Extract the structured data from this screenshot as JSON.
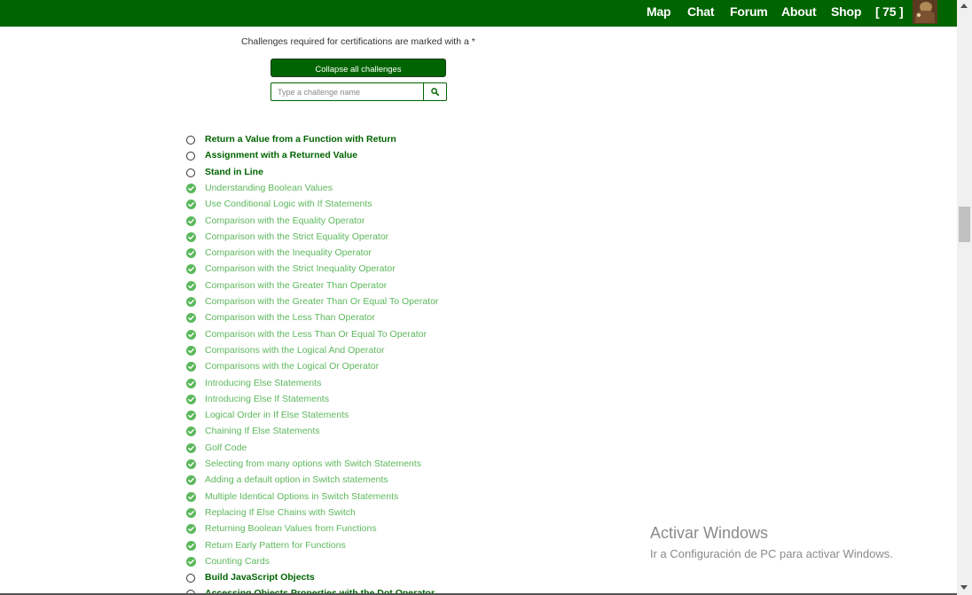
{
  "navbar": {
    "links": [
      "Map",
      "Chat",
      "Forum",
      "About",
      "Shop"
    ],
    "points": "[ 75 ]",
    "colors": {
      "background": "#006400",
      "text": "#ffffff"
    }
  },
  "intro": {
    "note": "Challenges required for certifications are marked with a *",
    "collapse_label": "Collapse all challenges",
    "search_placeholder": "Type a challenge name",
    "search_icon": "search-icon"
  },
  "challenges": [
    {
      "label": "Return a Value from a Function with Return",
      "done": false
    },
    {
      "label": "Assignment with a Returned Value",
      "done": false
    },
    {
      "label": "Stand in Line",
      "done": false
    },
    {
      "label": "Understanding Boolean Values",
      "done": true
    },
    {
      "label": "Use Conditional Logic with If Statements",
      "done": true
    },
    {
      "label": "Comparison with the Equality Operator",
      "done": true
    },
    {
      "label": "Comparison with the Strict Equality Operator",
      "done": true
    },
    {
      "label": "Comparison with the Inequality Operator",
      "done": true
    },
    {
      "label": "Comparison with the Strict Inequality Operator",
      "done": true
    },
    {
      "label": "Comparison with the Greater Than Operator",
      "done": true
    },
    {
      "label": "Comparison with the Greater Than Or Equal To Operator",
      "done": true
    },
    {
      "label": "Comparison with the Less Than Operator",
      "done": true
    },
    {
      "label": "Comparison with the Less Than Or Equal To Operator",
      "done": true
    },
    {
      "label": "Comparisons with the Logical And Operator",
      "done": true
    },
    {
      "label": "Comparisons with the Logical Or Operator",
      "done": true
    },
    {
      "label": "Introducing Else Statements",
      "done": true
    },
    {
      "label": "Introducing Else If Statements",
      "done": true
    },
    {
      "label": "Logical Order in If Else Statements",
      "done": true
    },
    {
      "label": "Chaining If Else Statements",
      "done": true
    },
    {
      "label": "Golf Code",
      "done": true
    },
    {
      "label": "Selecting from many options with Switch Statements",
      "done": true
    },
    {
      "label": "Adding a default option in Switch statements",
      "done": true
    },
    {
      "label": "Multiple Identical Options in Switch Statements",
      "done": true
    },
    {
      "label": "Replacing If Else Chains with Switch",
      "done": true
    },
    {
      "label": "Returning Boolean Values from Functions",
      "done": true
    },
    {
      "label": "Return Early Pattern for Functions",
      "done": true
    },
    {
      "label": "Counting Cards",
      "done": true
    },
    {
      "label": "Build JavaScript Objects",
      "done": false
    },
    {
      "label": "Accessing Objects Properties with the Dot Operator",
      "done": false
    }
  ],
  "status_colors": {
    "completed": "#5cb85c",
    "pending": "#006400"
  },
  "watermark": {
    "title": "Activar Windows",
    "subtitle": "Ir a Configuración de PC para activar Windows."
  }
}
